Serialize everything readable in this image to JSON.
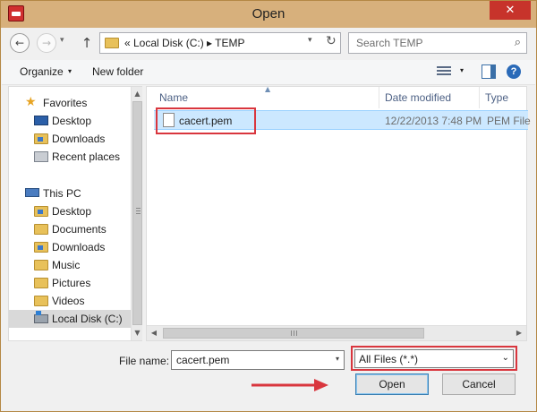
{
  "window": {
    "title": "Open",
    "close_glyph": "✕"
  },
  "nav": {
    "back_glyph": "←",
    "forward_glyph": "→",
    "history_glyph": "▾",
    "up_glyph": "↑"
  },
  "address": {
    "path": "«  Local Disk (C:)  ▸  TEMP",
    "dropdown_glyph": "▾",
    "refresh_glyph": "↻"
  },
  "search": {
    "placeholder": "Search TEMP",
    "icon_glyph": "⌕"
  },
  "toolbar": {
    "organize_label": "Organize",
    "dropdown_glyph": "▾",
    "new_folder_label": "New folder",
    "help_glyph": "?"
  },
  "sidebar": {
    "items": [
      {
        "label": "Favorites",
        "icon": "star-icon"
      },
      {
        "label": "Desktop",
        "icon": "desktop-icon"
      },
      {
        "label": "Downloads",
        "icon": "downloads-folder-icon"
      },
      {
        "label": "Recent places",
        "icon": "recent-places-icon"
      },
      {
        "label": "This PC",
        "icon": "computer-icon"
      },
      {
        "label": "Desktop",
        "icon": "desktop-folder-icon"
      },
      {
        "label": "Documents",
        "icon": "documents-folder-icon"
      },
      {
        "label": "Downloads",
        "icon": "downloads-folder-icon"
      },
      {
        "label": "Music",
        "icon": "music-folder-icon"
      },
      {
        "label": "Pictures",
        "icon": "pictures-folder-icon"
      },
      {
        "label": "Videos",
        "icon": "videos-folder-icon"
      },
      {
        "label": "Local Disk (C:)",
        "icon": "local-disk-icon"
      }
    ],
    "star_glyph": "★",
    "scroll_up_glyph": "▲",
    "scroll_down_glyph": "▼"
  },
  "filelist": {
    "columns": [
      "Name",
      "Date modified",
      "Type"
    ],
    "sort_glyph": "▲",
    "files": [
      {
        "name": "cacert.pem",
        "date": "12/22/2013 7:48 PM",
        "type": "PEM File"
      }
    ],
    "scroll_left_glyph": "◀",
    "scroll_right_glyph": "▶"
  },
  "footer": {
    "filename_label": "File name:",
    "filename_value": "cacert.pem",
    "dropdown_glyph": "▾",
    "filter_value": "All Files (*.*)",
    "filter_dropdown_glyph": "⌄",
    "open_label": "Open",
    "cancel_label": "Cancel"
  },
  "colors": {
    "highlight_box": "#d9363e",
    "selection": "#cce8ff",
    "title_bar": "#d7b07c"
  }
}
